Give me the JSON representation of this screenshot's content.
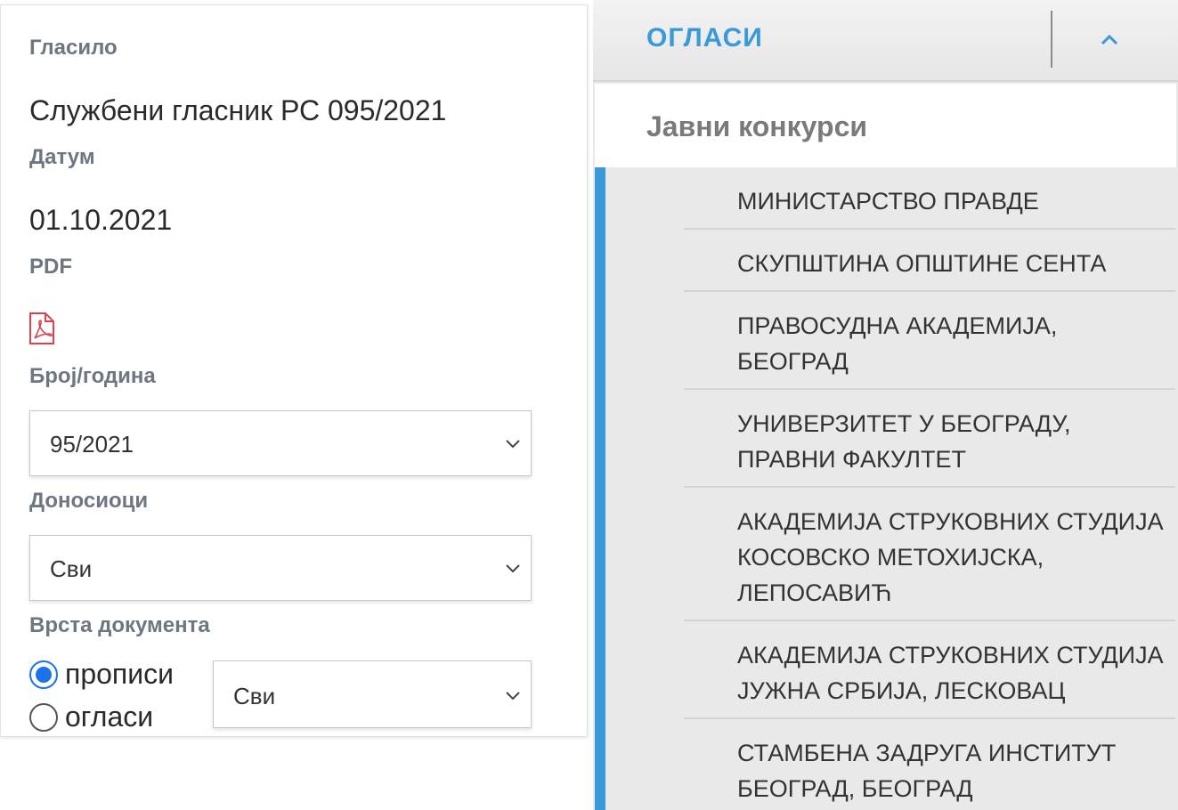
{
  "left": {
    "glasilo_label": "Гласило",
    "glasilo_value": "Службени гласник РС 095/2021",
    "datum_label": "Датум",
    "datum_value": "01.10.2021",
    "pdf_label": "PDF",
    "pdf_icon": "pdf-file-icon",
    "broj_label": "Број/година",
    "broj_select": "95/2021",
    "donosioci_label": "Доносиоци",
    "donosioci_select": "Сви",
    "vrsta_label": "Врста документа",
    "radio_propisi": "прописи",
    "radio_oglasi": "огласи",
    "vrsta_select": "Сви"
  },
  "right": {
    "accordion_title": "ОГЛАСИ",
    "sub_header": "Јавни конкурси",
    "accent_color": "#3a9ad9",
    "items": [
      {
        "label": "МИНИСТАРСТВО ПРАВДЕ"
      },
      {
        "label": "СКУПШТИНА ОПШТИНЕ СЕНТА"
      },
      {
        "label": "ПРАВОСУДНА АКАДЕМИЈА, БЕОГРАД"
      },
      {
        "label": "УНИВЕРЗИТЕТ У БЕОГРАДУ, ПРАВНИ ФАКУЛТЕТ"
      },
      {
        "label": "АКАДЕМИЈА СТРУКОВНИХ СТУДИЈА КОСОВСКО МЕТОХИЈСКА, ЛЕПОСАВИЋ"
      },
      {
        "label": "АКАДЕМИЈА СТРУКОВНИХ СТУДИЈА ЈУЖНА СРБИЈА, ЛЕСКОВАЦ"
      },
      {
        "label": "СТАМБЕНА ЗАДРУГА ИНСТИТУТ БЕОГРАД, БЕОГРАД"
      }
    ]
  }
}
